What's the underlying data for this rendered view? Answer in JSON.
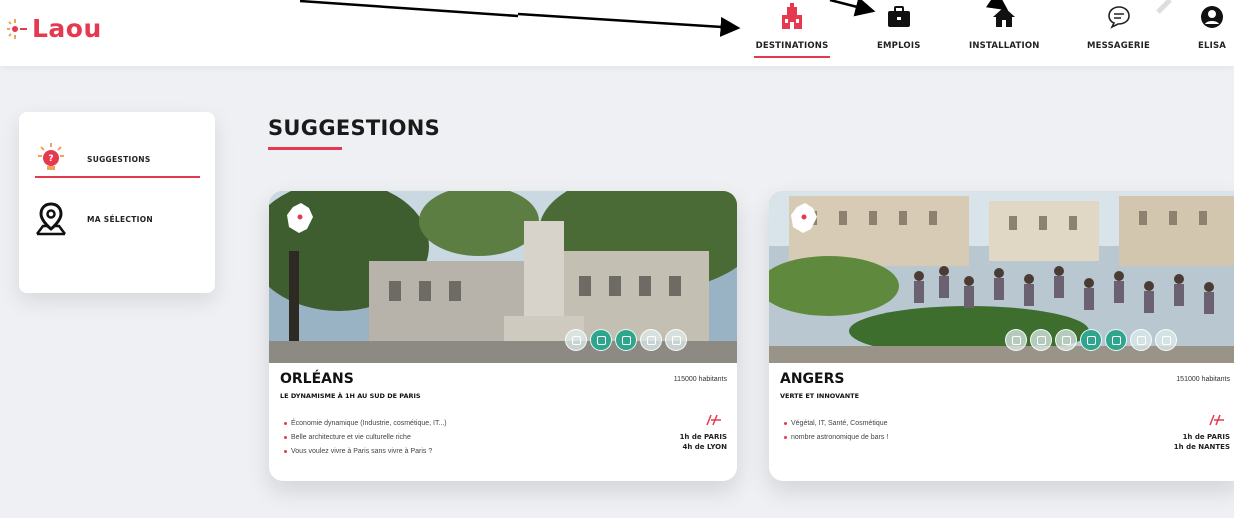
{
  "brand": {
    "name": "Laou",
    "color": "#e63950"
  },
  "nav": {
    "items": [
      {
        "label": "DESTINATIONS",
        "icon": "city-icon",
        "active": true
      },
      {
        "label": "EMPLOIS",
        "icon": "briefcase-icon",
        "active": false
      },
      {
        "label": "INSTALLATION",
        "icon": "home-icon",
        "active": false
      },
      {
        "label": "MESSAGERIE",
        "icon": "chat-icon",
        "active": false
      },
      {
        "label": "ELISA",
        "icon": "user-icon",
        "active": false
      }
    ]
  },
  "sidebar": {
    "items": [
      {
        "label": "SUGGESTIONS",
        "icon": "lightbulb-icon",
        "active": true
      },
      {
        "label": "MA SÉLECTION",
        "icon": "map-pin-icon",
        "active": false
      }
    ]
  },
  "main": {
    "title": "SUGGESTIONS",
    "cards": [
      {
        "city": "ORLÉANS",
        "tagline": "LE DYNAMISME À 1H AU SUD DE PARIS",
        "population": "115000 habitants",
        "bullets": [
          "Économie dynamique (Industrie, cosmétique, IT...)",
          "Belle architecture et vie culturelle riche",
          "Vous voulez vivre à Paris sans vivre à Paris ?"
        ],
        "travel": [
          "1h de PARIS",
          "4h de LYON"
        ]
      },
      {
        "city": "ANGERS",
        "tagline": "VERTE ET INNOVANTE",
        "population": "151000 habitants",
        "bullets": [
          "Végétal, IT, Santé, Cosmétique",
          "nombre astronomique de bars !"
        ],
        "travel": [
          "1h de PARIS",
          "1h de NANTES"
        ]
      }
    ]
  },
  "colors": {
    "accent": "#e63950",
    "teal": "#2fa58d",
    "background": "#eef0f4"
  }
}
